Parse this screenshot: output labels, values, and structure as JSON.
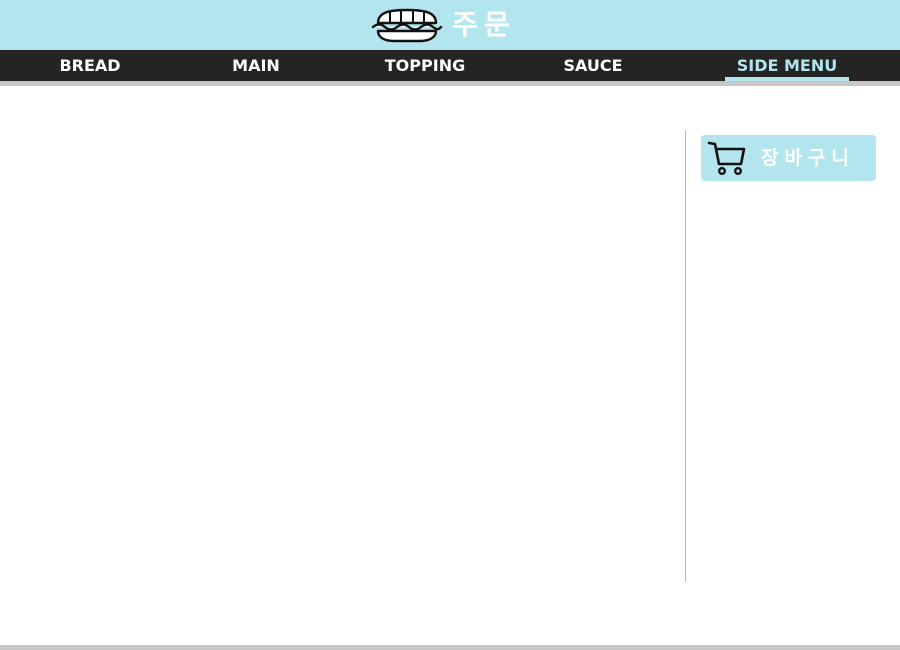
{
  "header": {
    "title": "주문",
    "logo_icon": "sandwich-icon"
  },
  "nav": {
    "tabs": [
      {
        "label": "BREAD",
        "active": false
      },
      {
        "label": "MAIN",
        "active": false
      },
      {
        "label": "TOPPING",
        "active": false
      },
      {
        "label": "SAUCE",
        "active": false
      },
      {
        "label": "SIDE MENU",
        "active": true
      }
    ]
  },
  "sidebar": {
    "cart_button": {
      "label": "장바구니",
      "icon": "shopping-cart-icon"
    }
  },
  "colors": {
    "accent": "#b3e5ef",
    "nav_background": "#242424",
    "text_on_accent": "#ffffff",
    "divider": "#c7c7c7"
  }
}
